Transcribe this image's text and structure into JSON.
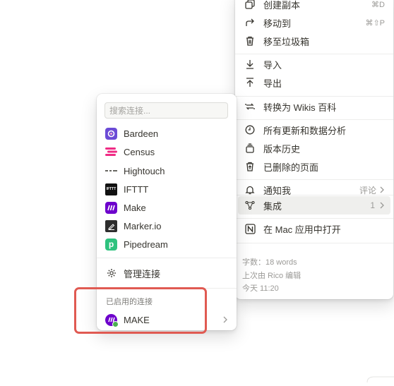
{
  "main_menu": {
    "items": [
      {
        "label": "创建副本",
        "shortcut": "⌘D",
        "icon": "duplicate-icon"
      },
      {
        "label": "移动到",
        "shortcut": "⌘⇧P",
        "icon": "move-arrow-icon"
      },
      {
        "label": "移至垃圾箱",
        "shortcut": "",
        "icon": "trash-icon"
      },
      {
        "label": "导入",
        "icon": "import-icon"
      },
      {
        "label": "导出",
        "icon": "export-icon"
      },
      {
        "label": "转换为 Wikis 百科",
        "icon": "convert-icon"
      },
      {
        "label": "所有更新和数据分析",
        "icon": "clock-icon"
      },
      {
        "label": "版本历史",
        "icon": "version-history-icon"
      },
      {
        "label": "已删除的页面",
        "icon": "deleted-pages-icon"
      },
      {
        "label": "通知我",
        "value": "评论",
        "icon": "bell-icon"
      },
      {
        "label": "集成",
        "value": "1",
        "icon": "integration-icon"
      },
      {
        "label": "在 Mac 应用中打开",
        "icon": "notion-app-icon"
      }
    ],
    "meta": {
      "word_count": "字数：18 words",
      "last_edited": "上次由 Rico 编辑",
      "time": "今天 11:20"
    }
  },
  "connections_menu": {
    "search_placeholder": "搜索连接...",
    "items": [
      {
        "label": "Bardeen",
        "icon": "bardeen-logo",
        "color": "#6b4bd6"
      },
      {
        "label": "Census",
        "icon": "census-logo",
        "color": "#ef2b84"
      },
      {
        "label": "Hightouch",
        "icon": "hightouch-logo",
        "color": "#37352f"
      },
      {
        "label": "IFTTT",
        "icon": "ifttt-logo",
        "color": "#111111"
      },
      {
        "label": "Make",
        "icon": "make-logo",
        "color": "#6d00cc"
      },
      {
        "label": "Marker.io",
        "icon": "markerio-logo",
        "color": "#2d2d2d"
      },
      {
        "label": "Pipedream",
        "icon": "pipedream-logo",
        "color": "#2ec27e"
      }
    ],
    "manage_label": "管理连接",
    "enabled_section_title": "已启用的连接",
    "enabled_item": {
      "label": "MAKE",
      "status_color": "#4caf50"
    }
  }
}
